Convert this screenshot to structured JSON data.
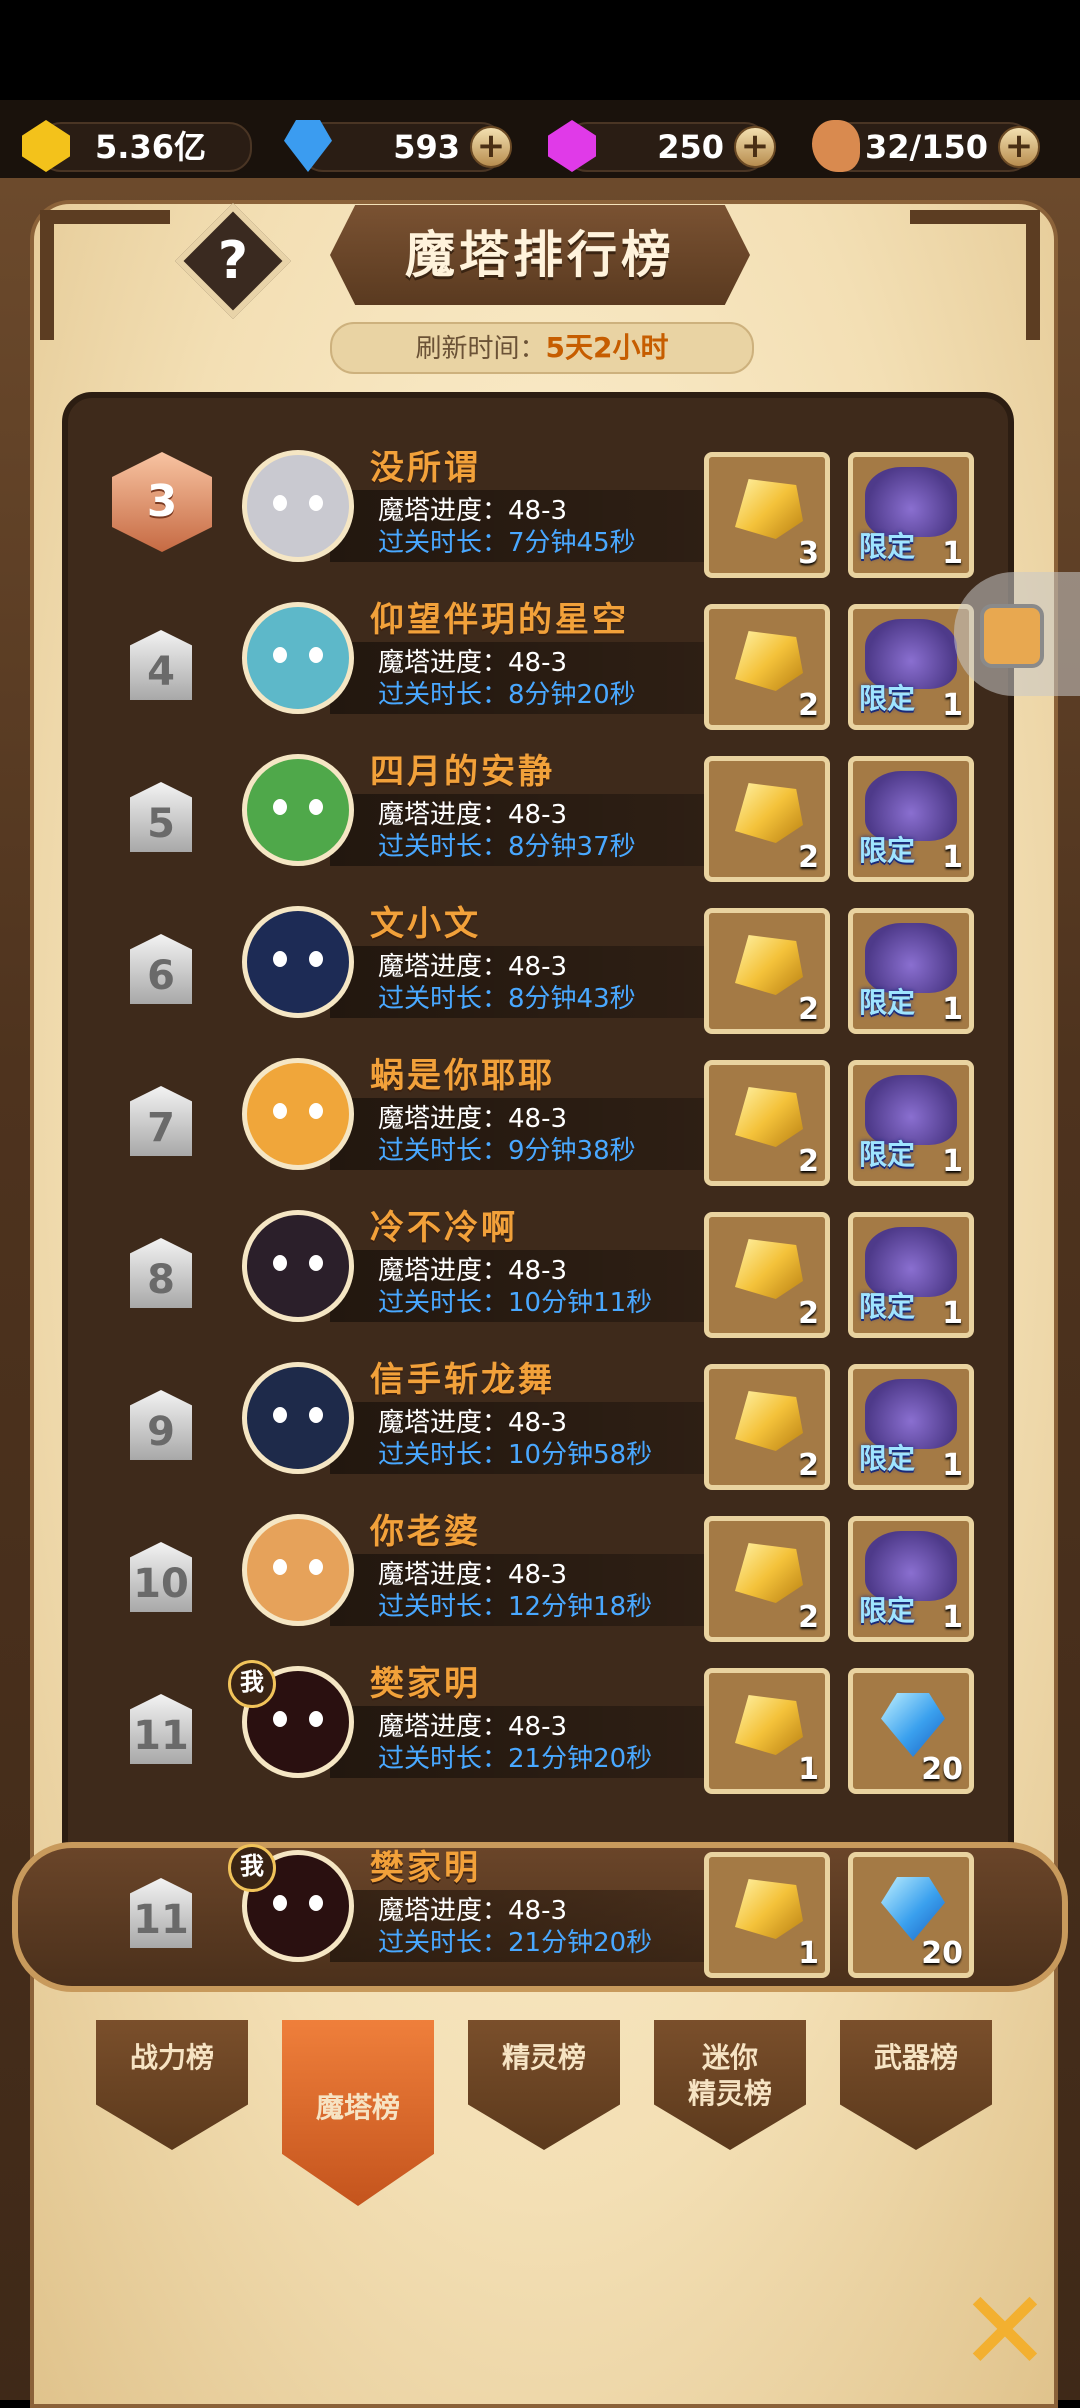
{
  "currencies": [
    {
      "name": "gold",
      "value": "5.36亿",
      "color": "#f3c21b",
      "has_plus": false
    },
    {
      "name": "diamond",
      "value": "593",
      "color": "#3b9cf0",
      "has_plus": true,
      "plus": "+"
    },
    {
      "name": "crystal",
      "value": "250",
      "color": "#e03ae8",
      "has_plus": true,
      "plus": "+"
    },
    {
      "name": "meat",
      "value": "32/150",
      "color": "#d98a4f",
      "has_plus": true,
      "plus": "+"
    }
  ],
  "header": {
    "title": "魔塔排行榜",
    "help_label": "?",
    "refresh_label": "刷新时间：",
    "refresh_value": "5天2小时"
  },
  "ranking": [
    {
      "rank": "3",
      "name": "没所谓",
      "progress": "魔塔进度：48-3",
      "time": "过关时长：7分钟45秒",
      "reward1_count": "3",
      "reward2_count": "1",
      "reward2": "限定",
      "avatar_color": "#c9c9d0",
      "me": false
    },
    {
      "rank": "4",
      "name": "仰望伴玥的星空",
      "progress": "魔塔进度：48-3",
      "time": "过关时长：8分钟20秒",
      "reward1_count": "2",
      "reward2_count": "1",
      "reward2": "限定",
      "avatar_color": "#5db8c9",
      "me": false
    },
    {
      "rank": "5",
      "name": "四月的安静",
      "progress": "魔塔进度：48-3",
      "time": "过关时长：8分钟37秒",
      "reward1_count": "2",
      "reward2_count": "1",
      "reward2": "限定",
      "avatar_color": "#4fa84a",
      "me": false
    },
    {
      "rank": "6",
      "name": "文小文",
      "progress": "魔塔进度：48-3",
      "time": "过关时长：8分钟43秒",
      "reward1_count": "2",
      "reward2_count": "1",
      "reward2": "限定",
      "avatar_color": "#1d2b55",
      "me": false
    },
    {
      "rank": "7",
      "name": "蜗是你耶耶",
      "progress": "魔塔进度：48-3",
      "time": "过关时长：9分钟38秒",
      "reward1_count": "2",
      "reward2_count": "1",
      "reward2": "限定",
      "avatar_color": "#f0a63a",
      "me": false
    },
    {
      "rank": "8",
      "name": "冷不冷啊",
      "progress": "魔塔进度：48-3",
      "time": "过关时长：10分钟11秒",
      "reward1_count": "2",
      "reward2_count": "1",
      "reward2": "限定",
      "avatar_color": "#2b1f2a",
      "me": false
    },
    {
      "rank": "9",
      "name": "信手斩龙舞",
      "progress": "魔塔进度：48-3",
      "time": "过关时长：10分钟58秒",
      "reward1_count": "2",
      "reward2_count": "1",
      "reward2": "限定",
      "avatar_color": "#1e2a4a",
      "me": false
    },
    {
      "rank": "10",
      "name": "你老婆",
      "progress": "魔塔进度：48-3",
      "time": "过关时长：12分钟18秒",
      "reward1_count": "2",
      "reward2_count": "1",
      "reward2": "限定",
      "avatar_color": "#e6a25a",
      "me": false
    },
    {
      "rank": "11",
      "name": "樊家明",
      "progress": "魔塔进度：48-3",
      "time": "过关时长：21分钟20秒",
      "reward1_count": "1",
      "reward2_count": "20",
      "reward2": "",
      "avatar_color": "#2a1010",
      "me": true,
      "me_label": "我"
    }
  ],
  "my_rank": {
    "rank": "11",
    "name": "樊家明",
    "progress": "魔塔进度：48-3",
    "time": "过关时长：21分钟20秒",
    "reward1_count": "1",
    "reward2_count": "20",
    "me_label": "我",
    "avatar_color": "#2a1010"
  },
  "tabs": [
    {
      "label": "战力榜",
      "active": false
    },
    {
      "label": "魔塔榜",
      "active": true
    },
    {
      "label": "精灵榜",
      "active": false
    },
    {
      "label": "迷你\n精灵榜",
      "active": false
    },
    {
      "label": "武器榜",
      "active": false
    }
  ],
  "close_label": "✕"
}
